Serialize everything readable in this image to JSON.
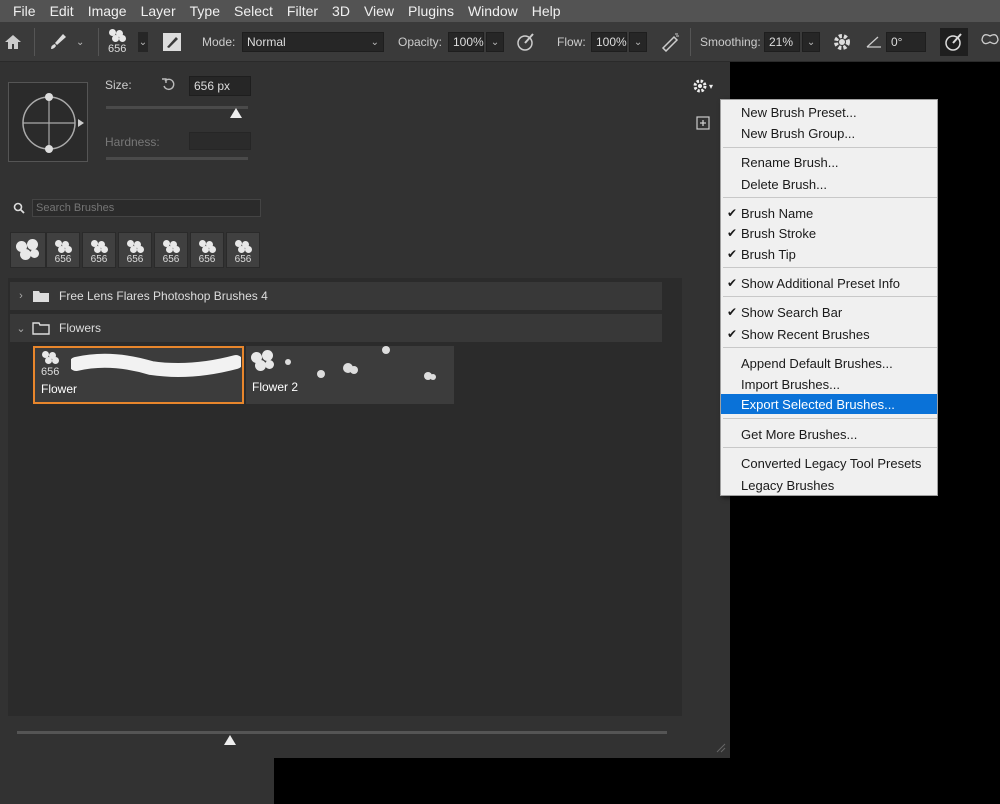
{
  "menubar": {
    "items": [
      "File",
      "Edit",
      "Image",
      "Layer",
      "Type",
      "Select",
      "Filter",
      "3D",
      "View",
      "Plugins",
      "Window",
      "Help"
    ]
  },
  "options": {
    "brush_size": "656",
    "mode_label": "Mode:",
    "mode_value": "Normal",
    "opacity_label": "Opacity:",
    "opacity_value": "100%",
    "flow_label": "Flow:",
    "flow_value": "100%",
    "smoothing_label": "Smoothing:",
    "smoothing_value": "21%",
    "angle_value": "0°"
  },
  "panel": {
    "size_label": "Size:",
    "size_value": "656 px",
    "hardness_label": "Hardness:",
    "search_placeholder": "Search Brushes",
    "recent_sizes": [
      "656",
      "656",
      "656",
      "656",
      "656",
      "656"
    ],
    "groups": [
      {
        "name": "Free Lens Flares Photoshop Brushes 4",
        "expanded": false
      },
      {
        "name": "Flowers",
        "expanded": true
      }
    ],
    "brushes": [
      {
        "size": "656",
        "name": "Flower",
        "selected": true
      },
      {
        "size": "",
        "name": "Flower 2",
        "selected": false
      }
    ]
  },
  "menu": {
    "items": [
      {
        "label": "New Brush Preset...",
        "checked": false
      },
      {
        "label": "New Brush Group...",
        "checked": false
      },
      {
        "label": "Rename Brush...",
        "checked": false
      },
      {
        "label": "Delete Brush...",
        "checked": false
      },
      {
        "label": "Brush Name",
        "checked": true
      },
      {
        "label": "Brush Stroke",
        "checked": true
      },
      {
        "label": "Brush Tip",
        "checked": true
      },
      {
        "label": "Show Additional Preset Info",
        "checked": true
      },
      {
        "label": "Show Search Bar",
        "checked": true
      },
      {
        "label": "Show Recent Brushes",
        "checked": true
      },
      {
        "label": "Append Default Brushes...",
        "checked": false
      },
      {
        "label": "Import Brushes...",
        "checked": false
      },
      {
        "label": "Export Selected Brushes...",
        "checked": false,
        "highlighted": true
      },
      {
        "label": "Get More Brushes...",
        "checked": false
      },
      {
        "label": "Converted Legacy Tool Presets",
        "checked": false
      },
      {
        "label": "Legacy Brushes",
        "checked": false
      }
    ]
  },
  "colors": {
    "highlight": "#0a72d8",
    "selection_border": "#e8862c"
  }
}
